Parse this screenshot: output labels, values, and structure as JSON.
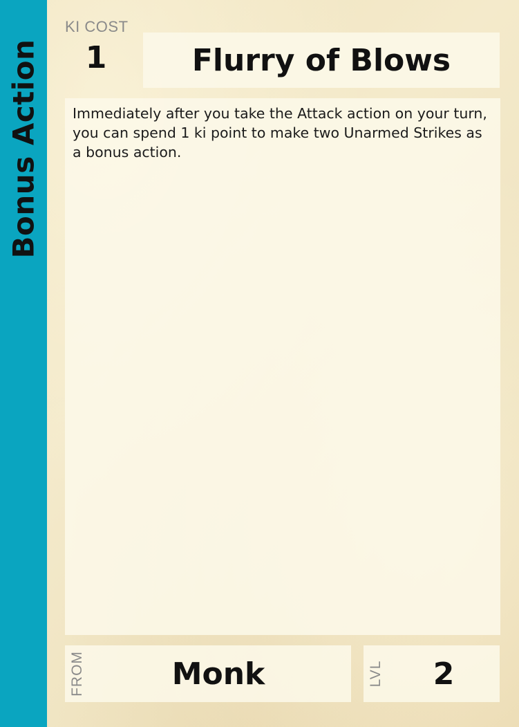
{
  "card": {
    "action_type": "Bonus Action",
    "cost_label": "KI COST",
    "cost_value": "1",
    "title": "Flurry of Blows",
    "description": "Immediately after you take the Attack action on your turn, you can spend 1 ki point to make two Unarmed Strikes as a bonus action.",
    "from_label": "FROM",
    "from_value": "Monk",
    "level_label": "LVL",
    "level_value": "2"
  },
  "colors": {
    "side_band": "#0aa5c0",
    "parchment": "#f1e6c2",
    "text": "#111111",
    "muted_label": "#8a8a8a"
  }
}
